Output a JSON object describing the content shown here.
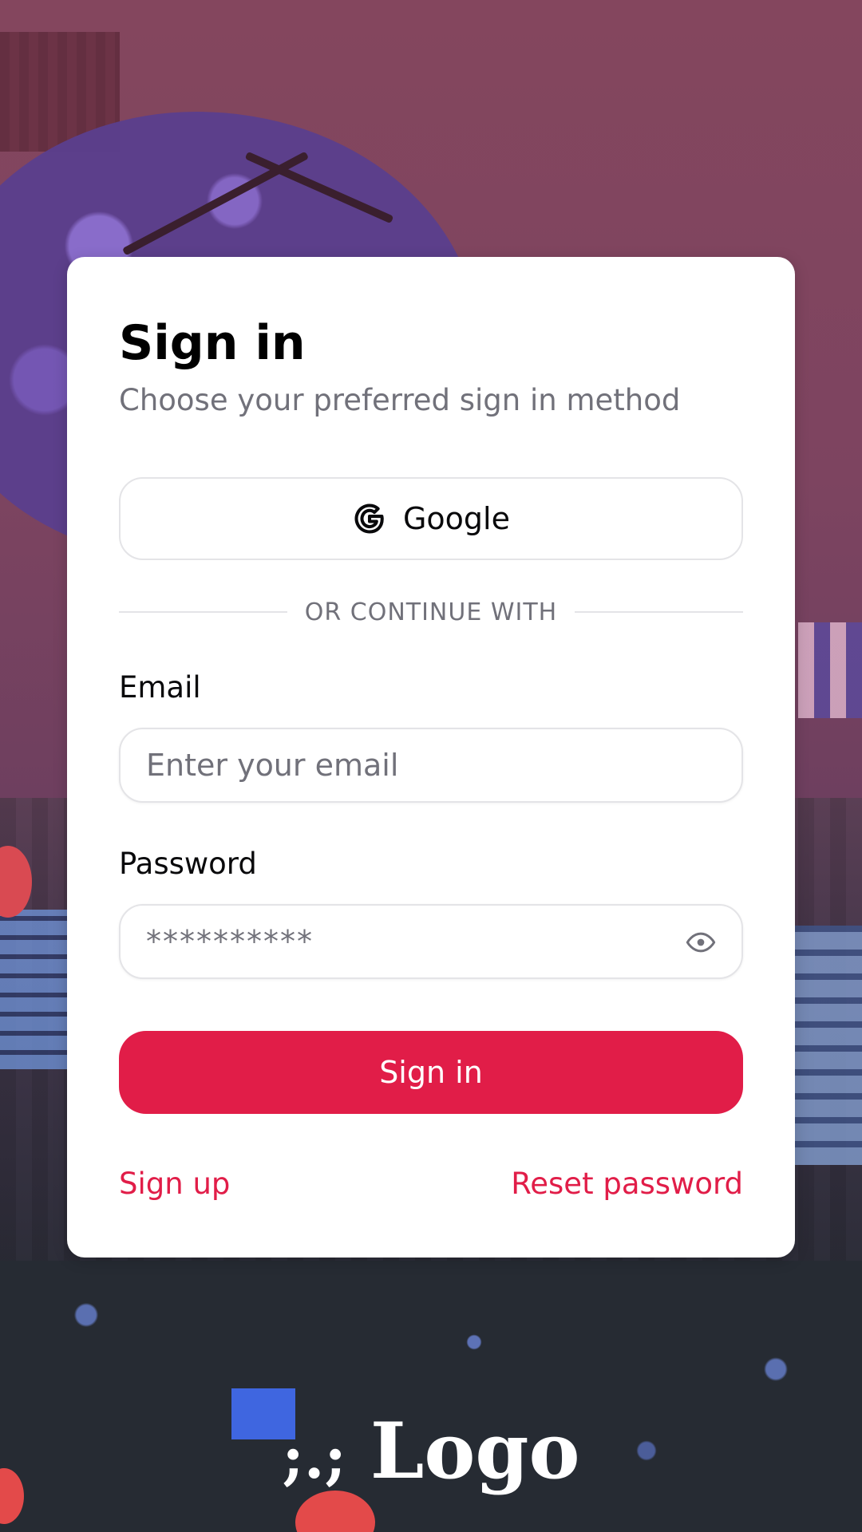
{
  "colors": {
    "accent": "#e11d48",
    "background": "#7f4560",
    "card": "#ffffff",
    "muted_text": "#71717a"
  },
  "signin": {
    "title": "Sign in",
    "subtitle": "Choose your preferred sign in method",
    "google_label": "Google",
    "google_icon": "google-icon",
    "divider_text": "OR CONTINUE WITH",
    "email_label": "Email",
    "email_placeholder": "Enter your email",
    "password_label": "Password",
    "password_placeholder": "**********",
    "password_toggle_icon": "eye-icon",
    "submit_label": "Sign in",
    "signup_link": "Sign up",
    "reset_link": "Reset password"
  },
  "logo": {
    "mark": ";.;",
    "text": "Logo"
  }
}
